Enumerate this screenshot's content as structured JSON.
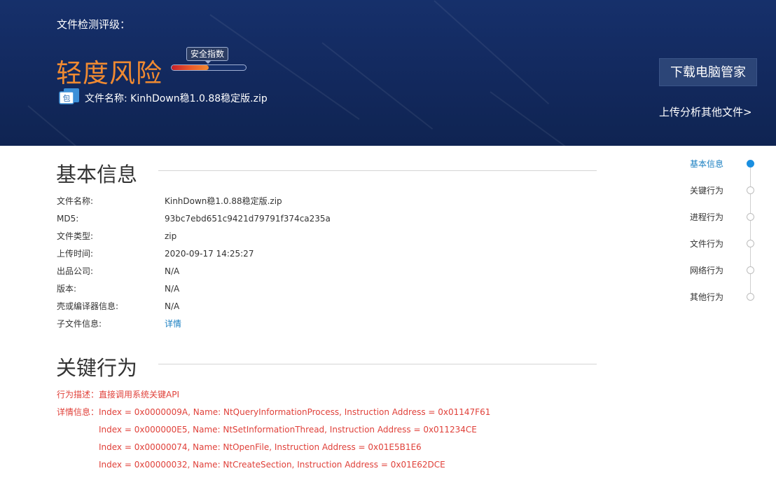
{
  "header": {
    "grade_label": "文件检测评级：",
    "risk_level": "轻度风险",
    "safety_index_label": "安全指数",
    "safety_index_fraction": 0.5,
    "file_icon_label": "包",
    "file_name_line": "文件名称:   KinhDown稳1.0.88稳定版.zip",
    "download_button": "下载电脑管家",
    "upload_link": "上传分析其他文件>"
  },
  "basic_info": {
    "title": "基本信息",
    "rows": [
      {
        "key": "文件名称:",
        "value": "KinhDown稳1.0.88稳定版.zip"
      },
      {
        "key": "MD5:",
        "value": "93bc7ebd651c9421d79791f374ca235a"
      },
      {
        "key": "文件类型:",
        "value": "zip"
      },
      {
        "key": "上传时间:",
        "value": "2020-09-17 14:25:27"
      },
      {
        "key": "出品公司:",
        "value": "N/A"
      },
      {
        "key": "版本:",
        "value": "N/A"
      },
      {
        "key": "壳或编译器信息:",
        "value": "N/A"
      },
      {
        "key": "子文件信息:",
        "value": "详情"
      }
    ]
  },
  "key_behavior": {
    "title": "关键行为",
    "description": "行为描述：直接调用系统关键API",
    "details_label": "详情信息：",
    "details": [
      "Index = 0x0000009A, Name: NtQueryInformationProcess, Instruction Address = 0x01147F61",
      "Index = 0x000000E5, Name: NtSetInformationThread, Instruction Address = 0x011234CE",
      "Index = 0x00000074, Name: NtOpenFile, Instruction Address = 0x01E5B1E6",
      "Index = 0x00000032, Name: NtCreateSection, Instruction Address = 0x01E62DCE"
    ]
  },
  "side_nav": {
    "items": [
      {
        "label": "基本信息",
        "active": true
      },
      {
        "label": "关键行为",
        "active": false
      },
      {
        "label": "进程行为",
        "active": false
      },
      {
        "label": "文件行为",
        "active": false
      },
      {
        "label": "网络行为",
        "active": false
      },
      {
        "label": "其他行为",
        "active": false
      }
    ]
  },
  "colors": {
    "header_bg": "#14306a",
    "risk_orange": "#f08a31",
    "accent_blue": "#1a7fc1",
    "detail_red": "#e0413a"
  }
}
